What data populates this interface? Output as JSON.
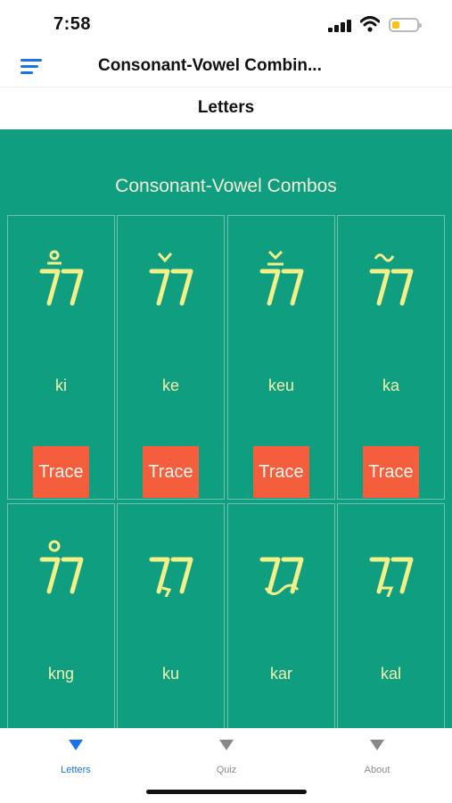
{
  "status": {
    "time": "7:58"
  },
  "header": {
    "title": "Consonant-Vowel Combin..."
  },
  "subheader": {
    "title": "Letters"
  },
  "main": {
    "section_title": "Consonant-Vowel Combos",
    "cards": [
      {
        "roman": "ki",
        "trace_label": "Trace",
        "mark": "ring-bar"
      },
      {
        "roman": "ke",
        "trace_label": "Trace",
        "mark": "caron"
      },
      {
        "roman": "keu",
        "trace_label": "Trace",
        "mark": "caron-bar"
      },
      {
        "roman": "ka",
        "trace_label": "Trace",
        "mark": "tilde"
      },
      {
        "roman": "kng",
        "mark": "ring"
      },
      {
        "roman": "ku",
        "mark": "comma-below"
      },
      {
        "roman": "kar",
        "mark": "swash-below"
      },
      {
        "roman": "kal",
        "mark": "hook-below"
      }
    ]
  },
  "tabs": [
    {
      "label": "Letters",
      "active": true
    },
    {
      "label": "Quiz",
      "active": false
    },
    {
      "label": "About",
      "active": false
    }
  ],
  "colors": {
    "primary": "#0f9e7f",
    "accent_blue": "#1a73e8",
    "trace_button": "#f45e3d",
    "glyph": "#f3f08a"
  }
}
